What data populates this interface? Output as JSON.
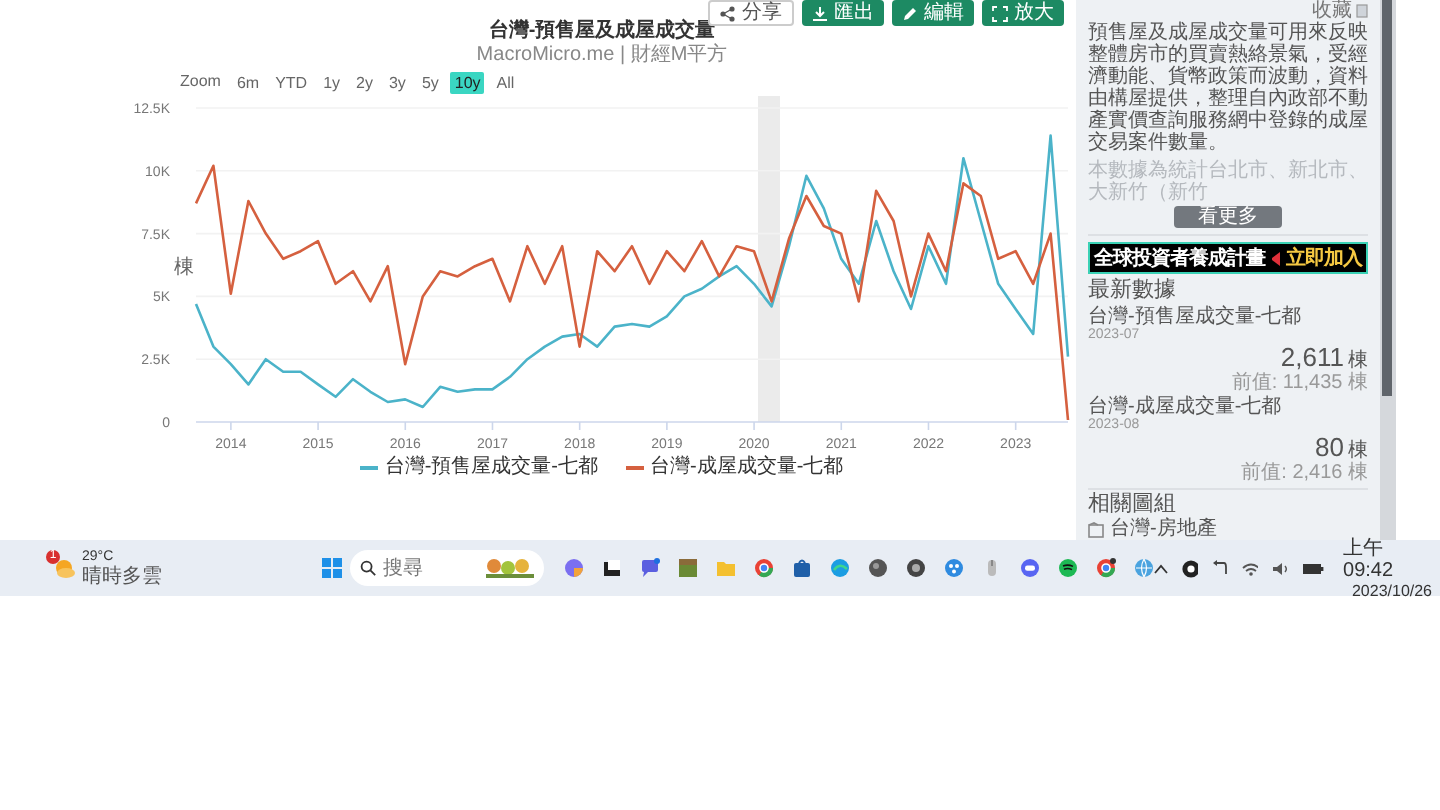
{
  "chart_header": {
    "buttons": [
      {
        "label": "分享",
        "kind": "outline"
      },
      {
        "label": "匯出",
        "kind": "solid"
      },
      {
        "label": "編輯",
        "kind": "solid"
      },
      {
        "label": "放大",
        "kind": "solid"
      }
    ],
    "title": "台灣-預售屋及成屋成交量",
    "subtitle": "MacroMicro.me | 財經M平方"
  },
  "range_selector": {
    "label": "Zoom",
    "options": [
      {
        "label": "6m",
        "selected": false
      },
      {
        "label": "YTD",
        "selected": false
      },
      {
        "label": "1y",
        "selected": false
      },
      {
        "label": "2y",
        "selected": false
      },
      {
        "label": "3y",
        "selected": false
      },
      {
        "label": "5y",
        "selected": false
      },
      {
        "label": "10y",
        "selected": true
      },
      {
        "label": "All",
        "selected": false
      }
    ]
  },
  "chart_data": {
    "type": "line",
    "ylabel": "棟",
    "ylim": [
      0,
      12500
    ],
    "xlim": [
      2013.6,
      2023.6
    ],
    "yticks": [
      {
        "value": 0,
        "label": "0"
      },
      {
        "value": 2500,
        "label": "2.5K"
      },
      {
        "value": 5000,
        "label": "5K"
      },
      {
        "value": 7500,
        "label": "7.5K"
      },
      {
        "value": 10000,
        "label": "10K"
      },
      {
        "value": 12500,
        "label": "12.5K"
      }
    ],
    "xticks": [
      {
        "value": 2014,
        "label": "2014"
      },
      {
        "value": 2015,
        "label": "2015"
      },
      {
        "value": 2016,
        "label": "2016"
      },
      {
        "value": 2017,
        "label": "2017"
      },
      {
        "value": 2018,
        "label": "2018"
      },
      {
        "value": 2019,
        "label": "2019"
      },
      {
        "value": 2020,
        "label": "2020"
      },
      {
        "value": 2021,
        "label": "2021"
      },
      {
        "value": 2022,
        "label": "2022"
      },
      {
        "value": 2023,
        "label": "2023"
      }
    ],
    "x": [
      2013.6,
      2013.8,
      2014.0,
      2014.2,
      2014.4,
      2014.6,
      2014.8,
      2015.0,
      2015.2,
      2015.4,
      2015.6,
      2015.8,
      2016.0,
      2016.2,
      2016.4,
      2016.6,
      2016.8,
      2017.0,
      2017.2,
      2017.4,
      2017.6,
      2017.8,
      2018.0,
      2018.2,
      2018.4,
      2018.6,
      2018.8,
      2019.0,
      2019.2,
      2019.4,
      2019.6,
      2019.8,
      2020.0,
      2020.2,
      2020.4,
      2020.6,
      2020.8,
      2021.0,
      2021.2,
      2021.4,
      2021.6,
      2021.8,
      2022.0,
      2022.2,
      2022.4,
      2022.6,
      2022.8,
      2023.0,
      2023.2,
      2023.4,
      2023.6
    ],
    "series": [
      {
        "name": "台灣-預售屋成交量-七都",
        "color": "#4bb3c9",
        "values": [
          4700,
          3000,
          2300,
          1500,
          2500,
          2000,
          2000,
          1500,
          1000,
          1700,
          1200,
          800,
          900,
          600,
          1400,
          1200,
          1300,
          1300,
          1800,
          2500,
          3000,
          3400,
          3500,
          3000,
          3800,
          3900,
          3800,
          4200,
          5000,
          5300,
          5800,
          6200,
          5500,
          4600,
          7000,
          9800,
          8500,
          6500,
          5500,
          8000,
          6000,
          4500,
          7000,
          5500,
          10500,
          8000,
          5500,
          4500,
          3500,
          11400,
          2600
        ]
      },
      {
        "name": "台灣-成屋成交量-七都",
        "color": "#d5603f",
        "values": [
          8700,
          10200,
          5100,
          8800,
          7500,
          6500,
          6800,
          7200,
          5500,
          6000,
          4800,
          6200,
          2300,
          5000,
          6000,
          5800,
          6200,
          6500,
          4800,
          7000,
          5500,
          7000,
          3000,
          6800,
          6000,
          7000,
          5500,
          6800,
          6000,
          7200,
          5800,
          7000,
          6800,
          4800,
          7300,
          9000,
          7800,
          7500,
          4800,
          9200,
          8000,
          5000,
          7500,
          6000,
          9500,
          9000,
          6500,
          6800,
          5500,
          7500,
          80
        ]
      }
    ],
    "grid": true
  },
  "sidebar": {
    "favorite_label": "收藏",
    "description": "預售屋及成屋成交量可用來反映整體房市的買賣熱絡景氣，受經濟動能、貨幣政策而波動，資料由構屋提供，整理自內政部不動產實價查詢服務網中登錄的成屋交易案件數量。",
    "description_more": "本數據為統計台北市、新北市、大新竹（新竹",
    "more_button": "看更多",
    "banner": {
      "title": "全球投資者養成計畫",
      "cta": "立即加入"
    },
    "latest_heading": "最新數據",
    "latest": [
      {
        "name": "台灣-預售屋成交量-七都",
        "date": "2023-07",
        "value": "2,611",
        "unit": "棟",
        "previous": "前值: 11,435 棟"
      },
      {
        "name": "台灣-成屋成交量-七都",
        "date": "2023-08",
        "value": "80",
        "unit": "棟",
        "previous": "前值: 2,416 棟"
      }
    ],
    "related_heading": "相關圖組",
    "related": [
      {
        "label": "台灣-房地產"
      }
    ]
  },
  "taskbar": {
    "weather": {
      "temperature": "29°C",
      "condition": "晴時多雲",
      "badge": "1"
    },
    "search": {
      "placeholder": "搜尋"
    },
    "clock": {
      "time": "上午 09:42",
      "date": "2023/10/26"
    }
  }
}
